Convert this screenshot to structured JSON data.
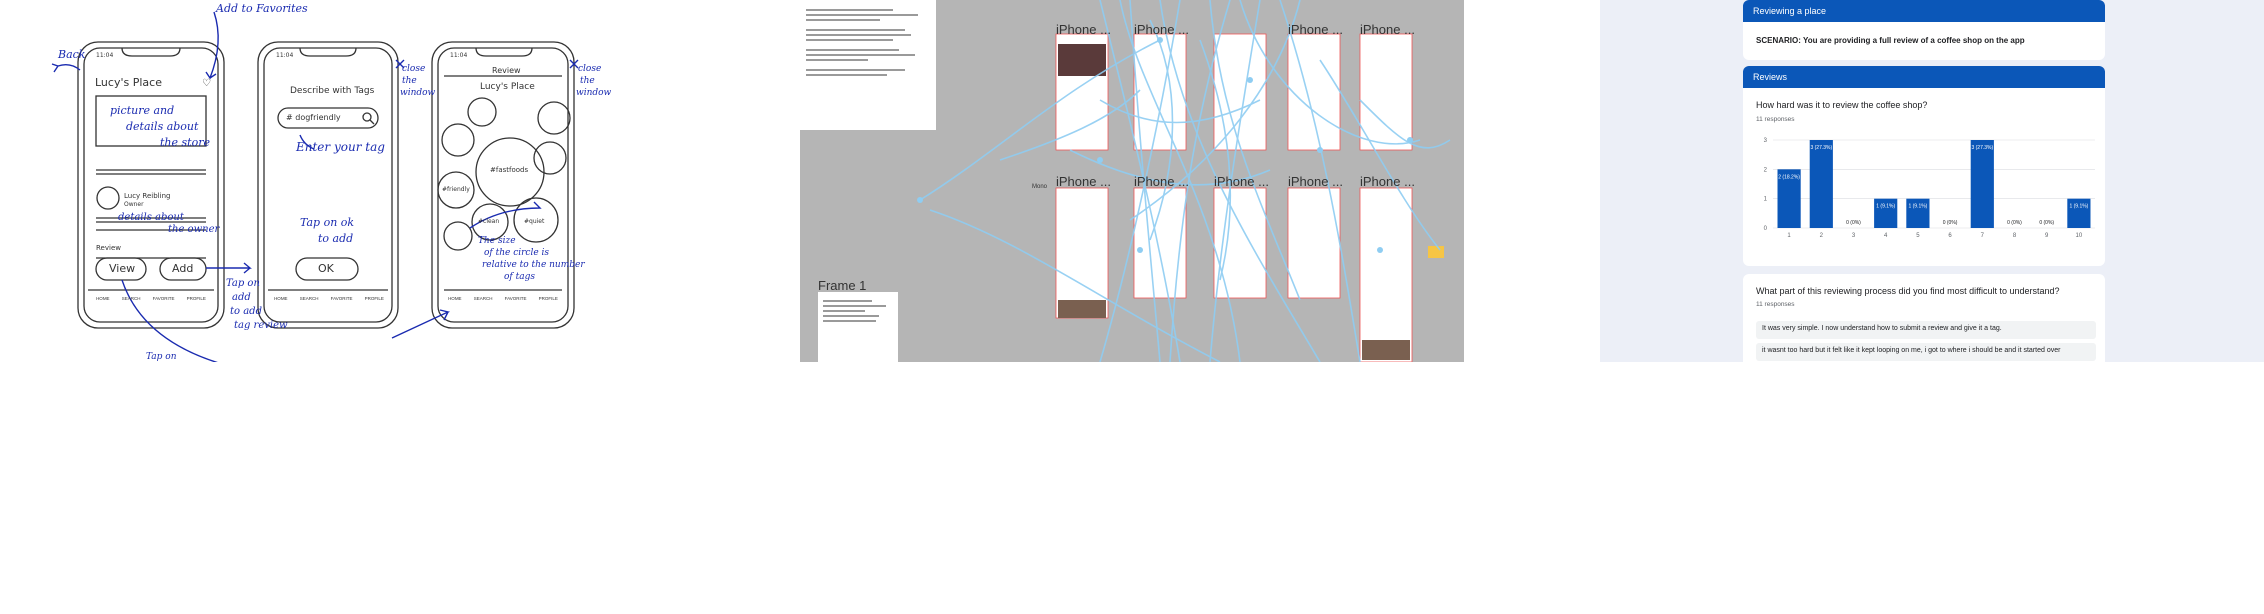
{
  "sketch": {
    "annotations": {
      "back": "Back",
      "add_favorites": "Add to Favorites",
      "picture_details": [
        "picture and",
        "details about",
        "the store"
      ],
      "owner_details": [
        "details about",
        "the owner"
      ],
      "enter_tag": "Enter your tag",
      "tap_ok": [
        "Tap on ok",
        "to add"
      ],
      "tap_add": [
        "Tap on",
        "add",
        "to add",
        "tag review"
      ],
      "close1": [
        "close",
        "the",
        "window"
      ],
      "close2": [
        "close",
        "the",
        "window"
      ],
      "circle_note": [
        "The size",
        "of the circle is",
        "relative to the number",
        "of tags"
      ],
      "tap_on": "Tap on"
    },
    "phone1": {
      "time": "11:04",
      "title": "Lucy's Place",
      "owner_name": "Lucy Reibling",
      "owner_role": "Owner",
      "review_label": "Review",
      "view_btn": "View",
      "add_btn": "Add",
      "nav": [
        "HOME",
        "SEARCH",
        "FAVORITE",
        "PROFILE"
      ]
    },
    "phone2": {
      "time": "11:04",
      "title": "Describe with Tags",
      "search_value": "# dogfriendly",
      "ok_btn": "OK",
      "nav": [
        "HOME",
        "SEARCH",
        "FAVORITE",
        "PROFILE"
      ]
    },
    "phone3": {
      "time": "11:04",
      "header": "Review",
      "title": "Lucy's Place",
      "tags": [
        "#fastfoods",
        "#friendly",
        "#clean",
        "#quiet"
      ],
      "nav": [
        "HOME",
        "SEARCH",
        "FAVORITE",
        "PROFILE"
      ]
    }
  },
  "figma": {
    "frame_label": "Frame 1",
    "iphone_labels": [
      "iPhone ...",
      "iPhone ...",
      "iPhone ...",
      "iPhone ...",
      "iPhone ...",
      "iPhone ...",
      "iPhone ...",
      "iPhone ...",
      "iPhone ..."
    ],
    "wordmark": "Mono"
  },
  "forms": {
    "header_title": "Reviewing a place",
    "scenario": "SCENARIO: You are providing a full review of a coffee shop on the app",
    "section_title": "Reviews",
    "q1": {
      "title": "How hard was it to review the coffee shop?",
      "responses": "11 responses"
    },
    "q2": {
      "title": "What part of this reviewing process did you find most difficult to understand?",
      "responses": "11 responses",
      "answers": [
        "It was very simple. I now understand how to submit a review and give it a tag.",
        "it wasnt too hard but it felt like it kept looping on me, i got to where i should be and it started over"
      ]
    },
    "colors": {
      "accent": "#0b57b8",
      "bar": "#0b57b8",
      "background": "#eceff7"
    }
  },
  "chart_data": {
    "type": "bar",
    "title": "How hard was it to review the coffee shop?",
    "categories": [
      "1",
      "2",
      "3",
      "4",
      "5",
      "6",
      "7",
      "8",
      "9",
      "10"
    ],
    "values": [
      2,
      3,
      0,
      1,
      1,
      0,
      3,
      0,
      0,
      1
    ],
    "data_labels": [
      "2 (18.2%)",
      "3 (27.3%)",
      "0 (0%)",
      "1 (9.1%)",
      "1 (9.1%)",
      "0 (0%)",
      "3 (27.3%)",
      "0 (0%)",
      "0 (0%)",
      "1 (9.1%)"
    ],
    "yticks": [
      "0",
      "1",
      "2",
      "3"
    ],
    "ylim": [
      0,
      3
    ],
    "grid": true
  }
}
